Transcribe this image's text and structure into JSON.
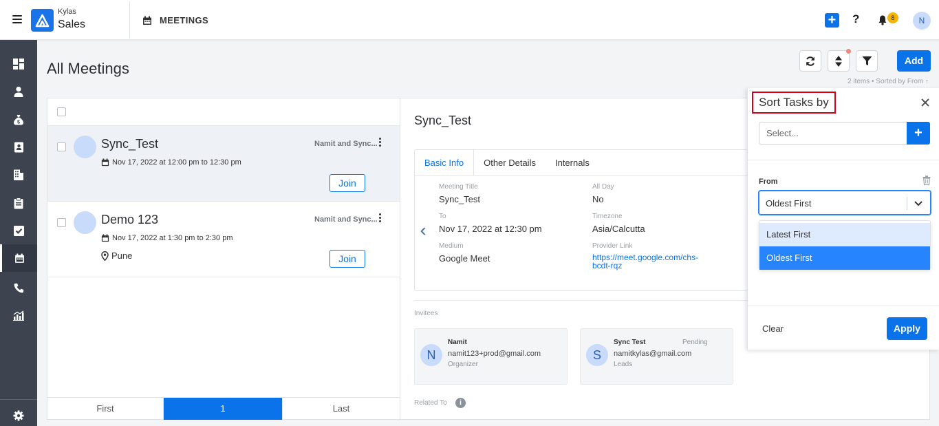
{
  "header": {
    "brand_top": "Kylas",
    "brand_main": "Sales",
    "module": "MEETINGS",
    "notification_count": "8",
    "avatar_initial": "N"
  },
  "sidebar": {
    "items": [
      "dashboard",
      "contacts",
      "deals",
      "leads",
      "companies",
      "tasks-clipboard",
      "tasks",
      "meetings",
      "calls",
      "reports"
    ],
    "active": "meetings"
  },
  "page": {
    "title": "All Meetings",
    "add_label": "Add",
    "sort_summary": "2 items • Sorted by From ↑"
  },
  "meetings": [
    {
      "title": "Sync_Test",
      "owner": "Namit and Sync...",
      "time": "Nov 17, 2022 at 12:00 pm to 12:30 pm",
      "location": "",
      "join": "Join"
    },
    {
      "title": "Demo 123",
      "owner": "Namit and Sync...",
      "time": "Nov 17, 2022 at 1:30 pm to 2:30 pm",
      "location": "Pune",
      "join": "Join"
    }
  ],
  "pager": {
    "first": "First",
    "current": "1",
    "last": "Last"
  },
  "detail": {
    "title": "Sync_Test",
    "tabs": [
      "Basic Info",
      "Other Details",
      "Internals"
    ],
    "fields": {
      "meeting_title_label": "Meeting Title",
      "meeting_title": "Sync_Test",
      "all_day_label": "All Day",
      "all_day": "No",
      "to_label": "To",
      "to": "Nov 17, 2022 at 12:30 pm",
      "timezone_label": "Timezone",
      "timezone": "Asia/Calcutta",
      "medium_label": "Medium",
      "medium": "Google Meet",
      "provider_label": "Provider Link",
      "provider": "https://meet.google.com/chs-bcdt-rqz"
    },
    "invitees_label": "Invitees",
    "invitees": [
      {
        "initial": "N",
        "name": "Namit",
        "email": "namit123+prod@gmail.com",
        "role": "Organizer",
        "status": ""
      },
      {
        "initial": "S",
        "name": "Sync Test",
        "email": "namitkylas@gmail.com",
        "role": "Leads",
        "status": "Pending"
      }
    ],
    "related_label": "Related To"
  },
  "sort_panel": {
    "title": "Sort Tasks by",
    "select_placeholder": "Select...",
    "field_label": "From",
    "selected": "Oldest First",
    "options": [
      "Latest First",
      "Oldest First"
    ],
    "clear": "Clear",
    "apply": "Apply"
  },
  "colors": {
    "primary": "#0b73e9",
    "sidebar": "#3d4450",
    "highlight": "#d0021b"
  }
}
